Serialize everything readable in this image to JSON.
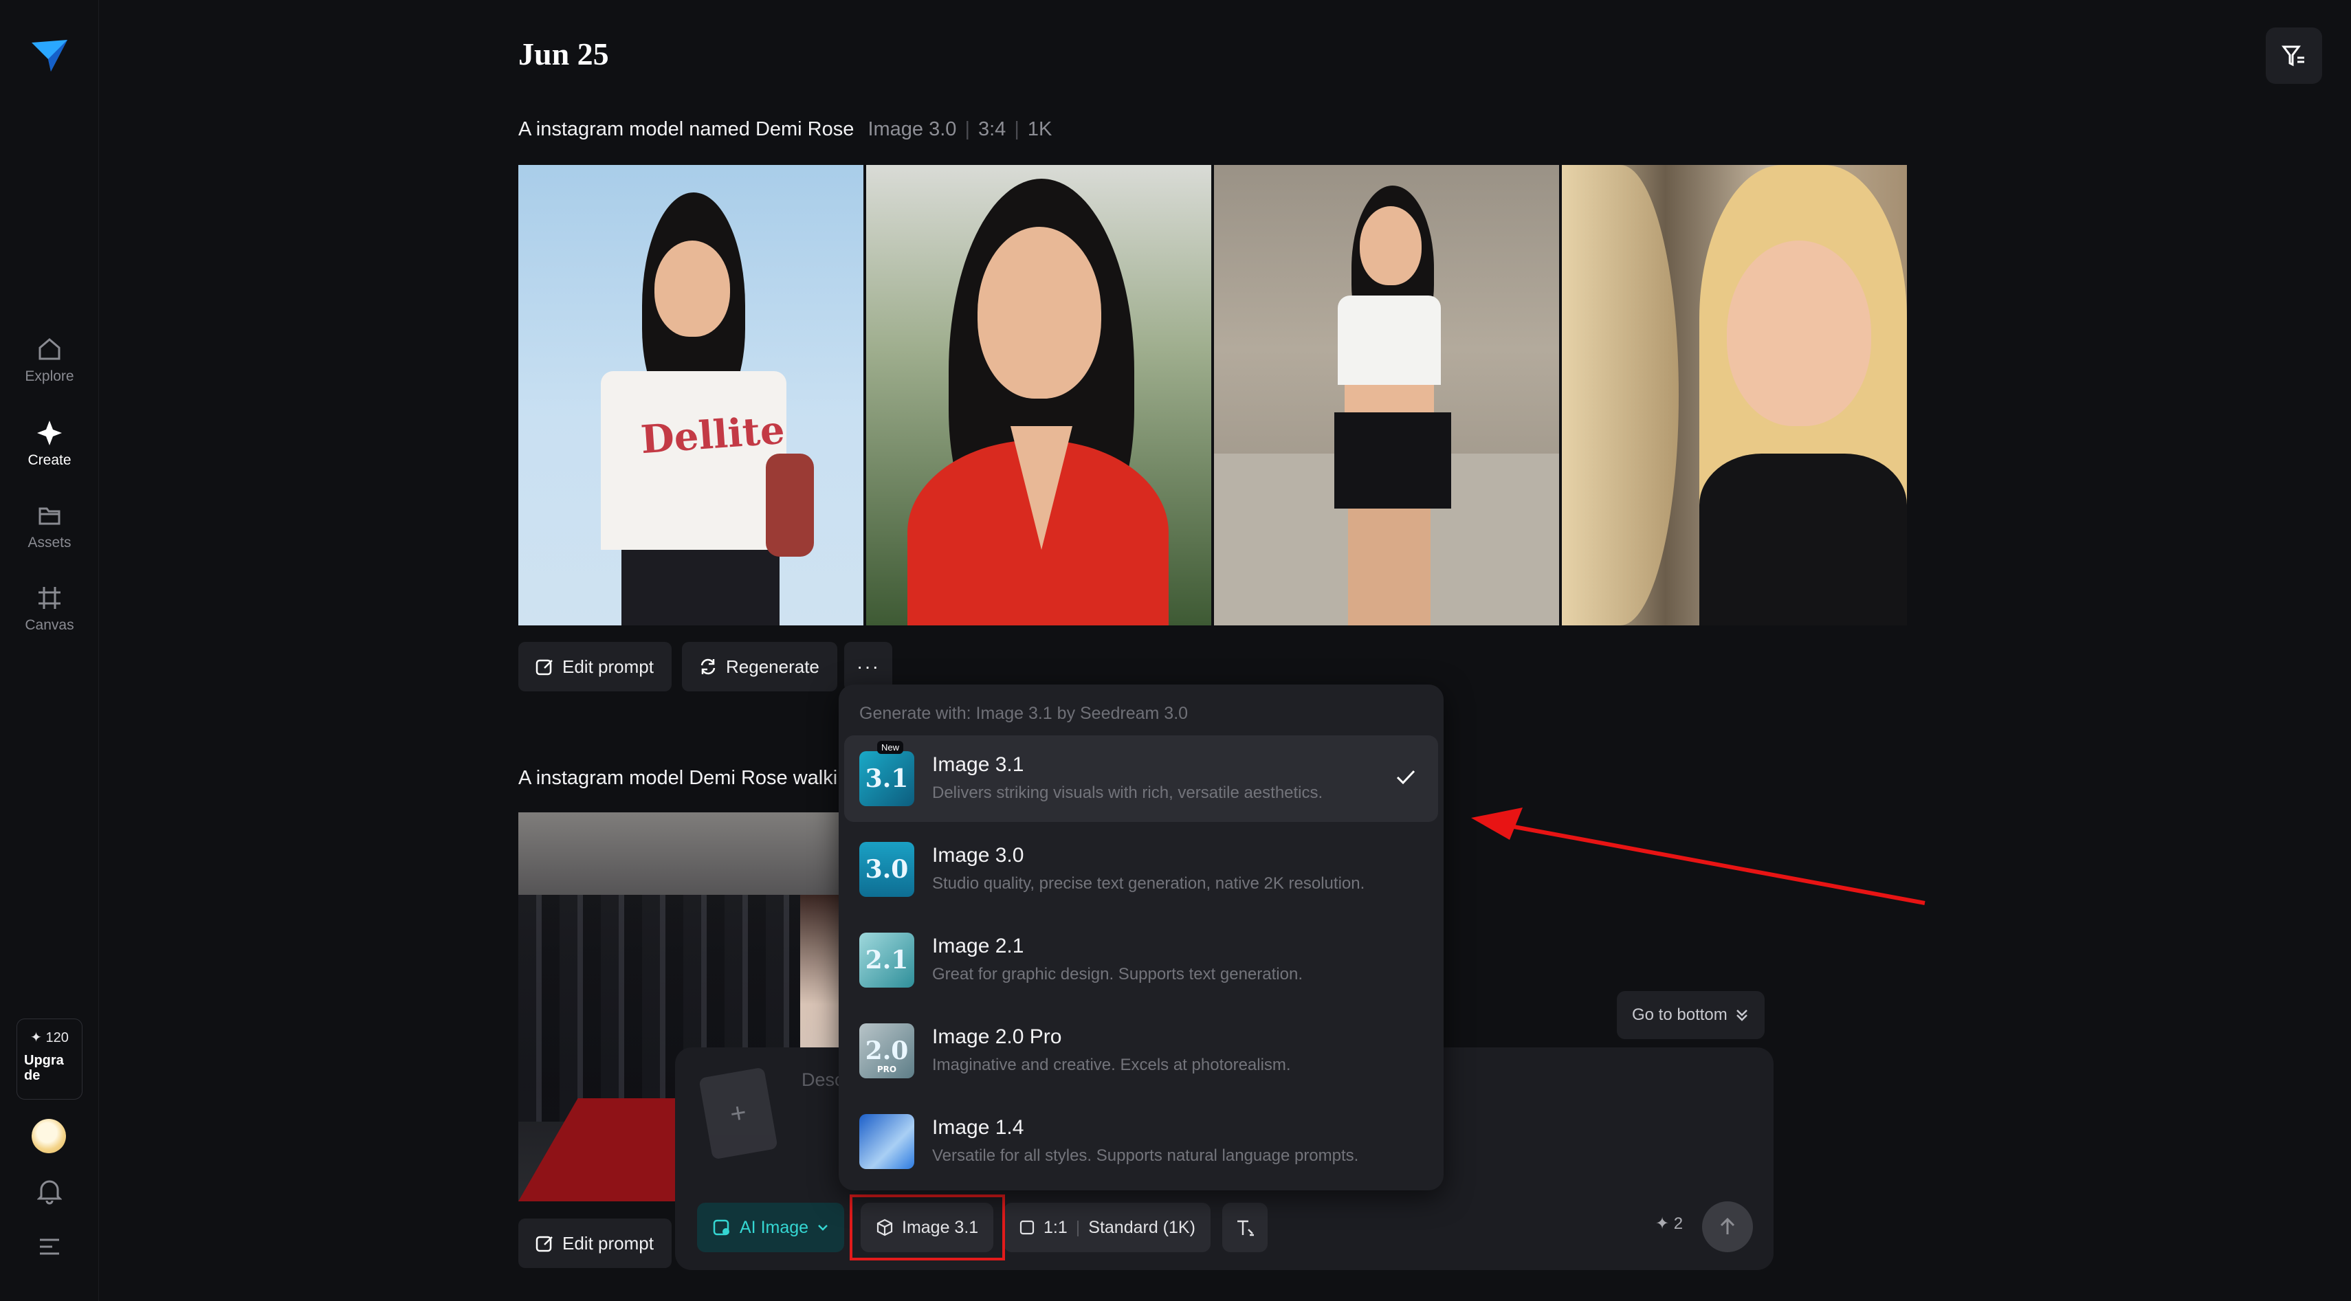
{
  "nav": {
    "items": [
      {
        "label": "Explore",
        "icon": "home-icon"
      },
      {
        "label": "Create",
        "icon": "sparkle-icon"
      },
      {
        "label": "Assets",
        "icon": "folder-icon"
      },
      {
        "label": "Canvas",
        "icon": "canvas-icon"
      }
    ],
    "credits": "120",
    "upgrade": "Upgrade",
    "upgrade_line1": "Upgra",
    "upgrade_line2": "de"
  },
  "header": {
    "date": "Jun 25"
  },
  "generation1": {
    "prompt": "A instagram model named Demi Rose",
    "model": "Image 3.0",
    "ratio": "3:4",
    "resolution": "1K",
    "actions": {
      "edit": "Edit prompt",
      "regenerate": "Regenerate",
      "more": "···"
    }
  },
  "generation2": {
    "prompt": "A instagram model Demi Rose walkir",
    "actions": {
      "edit": "Edit prompt"
    }
  },
  "dropdown": {
    "heading": "Generate with: Image 3.1 by Seedream 3.0",
    "items": [
      {
        "title": "Image 3.1",
        "desc": "Delivers striking visuals with rich, versatile aesthetics.",
        "thumb": "3.1",
        "badge": "New",
        "selected": true
      },
      {
        "title": "Image 3.0",
        "desc": "Studio quality, precise text generation, native 2K resolution.",
        "thumb": "3.0"
      },
      {
        "title": "Image 2.1",
        "desc": "Great for graphic design. Supports text generation.",
        "thumb": "2.1"
      },
      {
        "title": "Image 2.0 Pro",
        "desc": "Imaginative and creative. Excels at photorealism.",
        "thumb": "2.0",
        "thumb_sub": "PRO"
      },
      {
        "title": "Image 1.4",
        "desc": "Versatile for all styles. Supports natural language prompts.",
        "thumb": ""
      }
    ]
  },
  "go_bottom": "Go to bottom",
  "composer": {
    "placeholder": "Desc",
    "mode": "AI Image",
    "model": "Image 3.1",
    "ratio": "1:1",
    "quality": "Standard (1K)",
    "cost": "2"
  },
  "colors": {
    "accent": "#35d6d2",
    "highlight": "#e21b1b",
    "background": "#0f1013"
  }
}
